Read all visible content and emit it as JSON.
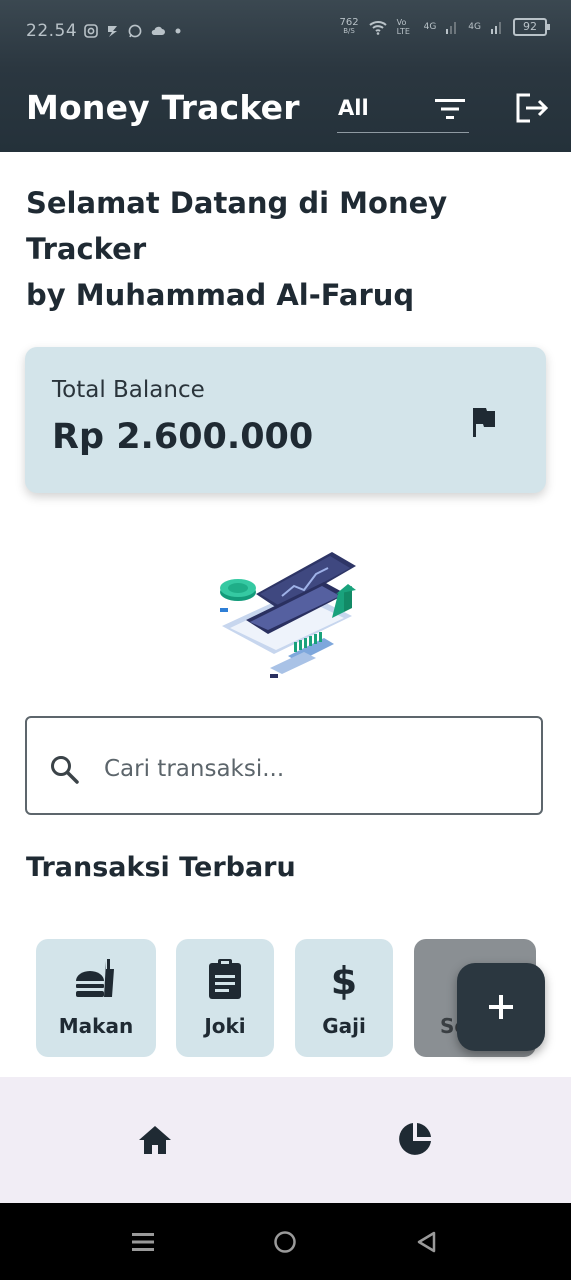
{
  "status_bar": {
    "time": "22.54",
    "speed": "762",
    "speed_unit": "B/S",
    "net1": "Vo LTE",
    "net2": "4G",
    "net3": "4G",
    "battery": "92"
  },
  "appbar": {
    "title": "Money Tracker",
    "filter_value": "All",
    "icons": [
      "filter-icon",
      "logout-icon"
    ]
  },
  "welcome": {
    "line1": "Selamat Datang di Money",
    "line2": "Tracker",
    "line3": "by Muhammad Al-Faruq"
  },
  "balance_card": {
    "label": "Total Balance",
    "amount": "Rp 2.600.000",
    "icon": "flag-icon"
  },
  "search": {
    "placeholder": "Cari transaksi...",
    "value": ""
  },
  "section_title": "Transaksi Terbaru",
  "categories": [
    {
      "label": "Makan",
      "icon": "fastfood-icon"
    },
    {
      "label": "Joki",
      "icon": "clipboard-icon"
    },
    {
      "label": "Gaji",
      "icon": "dollar-icon"
    },
    {
      "label": "Se",
      "icon": "unknown-icon"
    }
  ],
  "fab": {
    "icon": "add-icon"
  },
  "bottom_nav": [
    {
      "name": "home",
      "icon": "home-icon"
    },
    {
      "name": "chart",
      "icon": "pie-chart-icon"
    }
  ],
  "colors": {
    "primary": "#2b3740",
    "card": "#d3e4ea",
    "bottom_nav": "#f1edf5"
  }
}
